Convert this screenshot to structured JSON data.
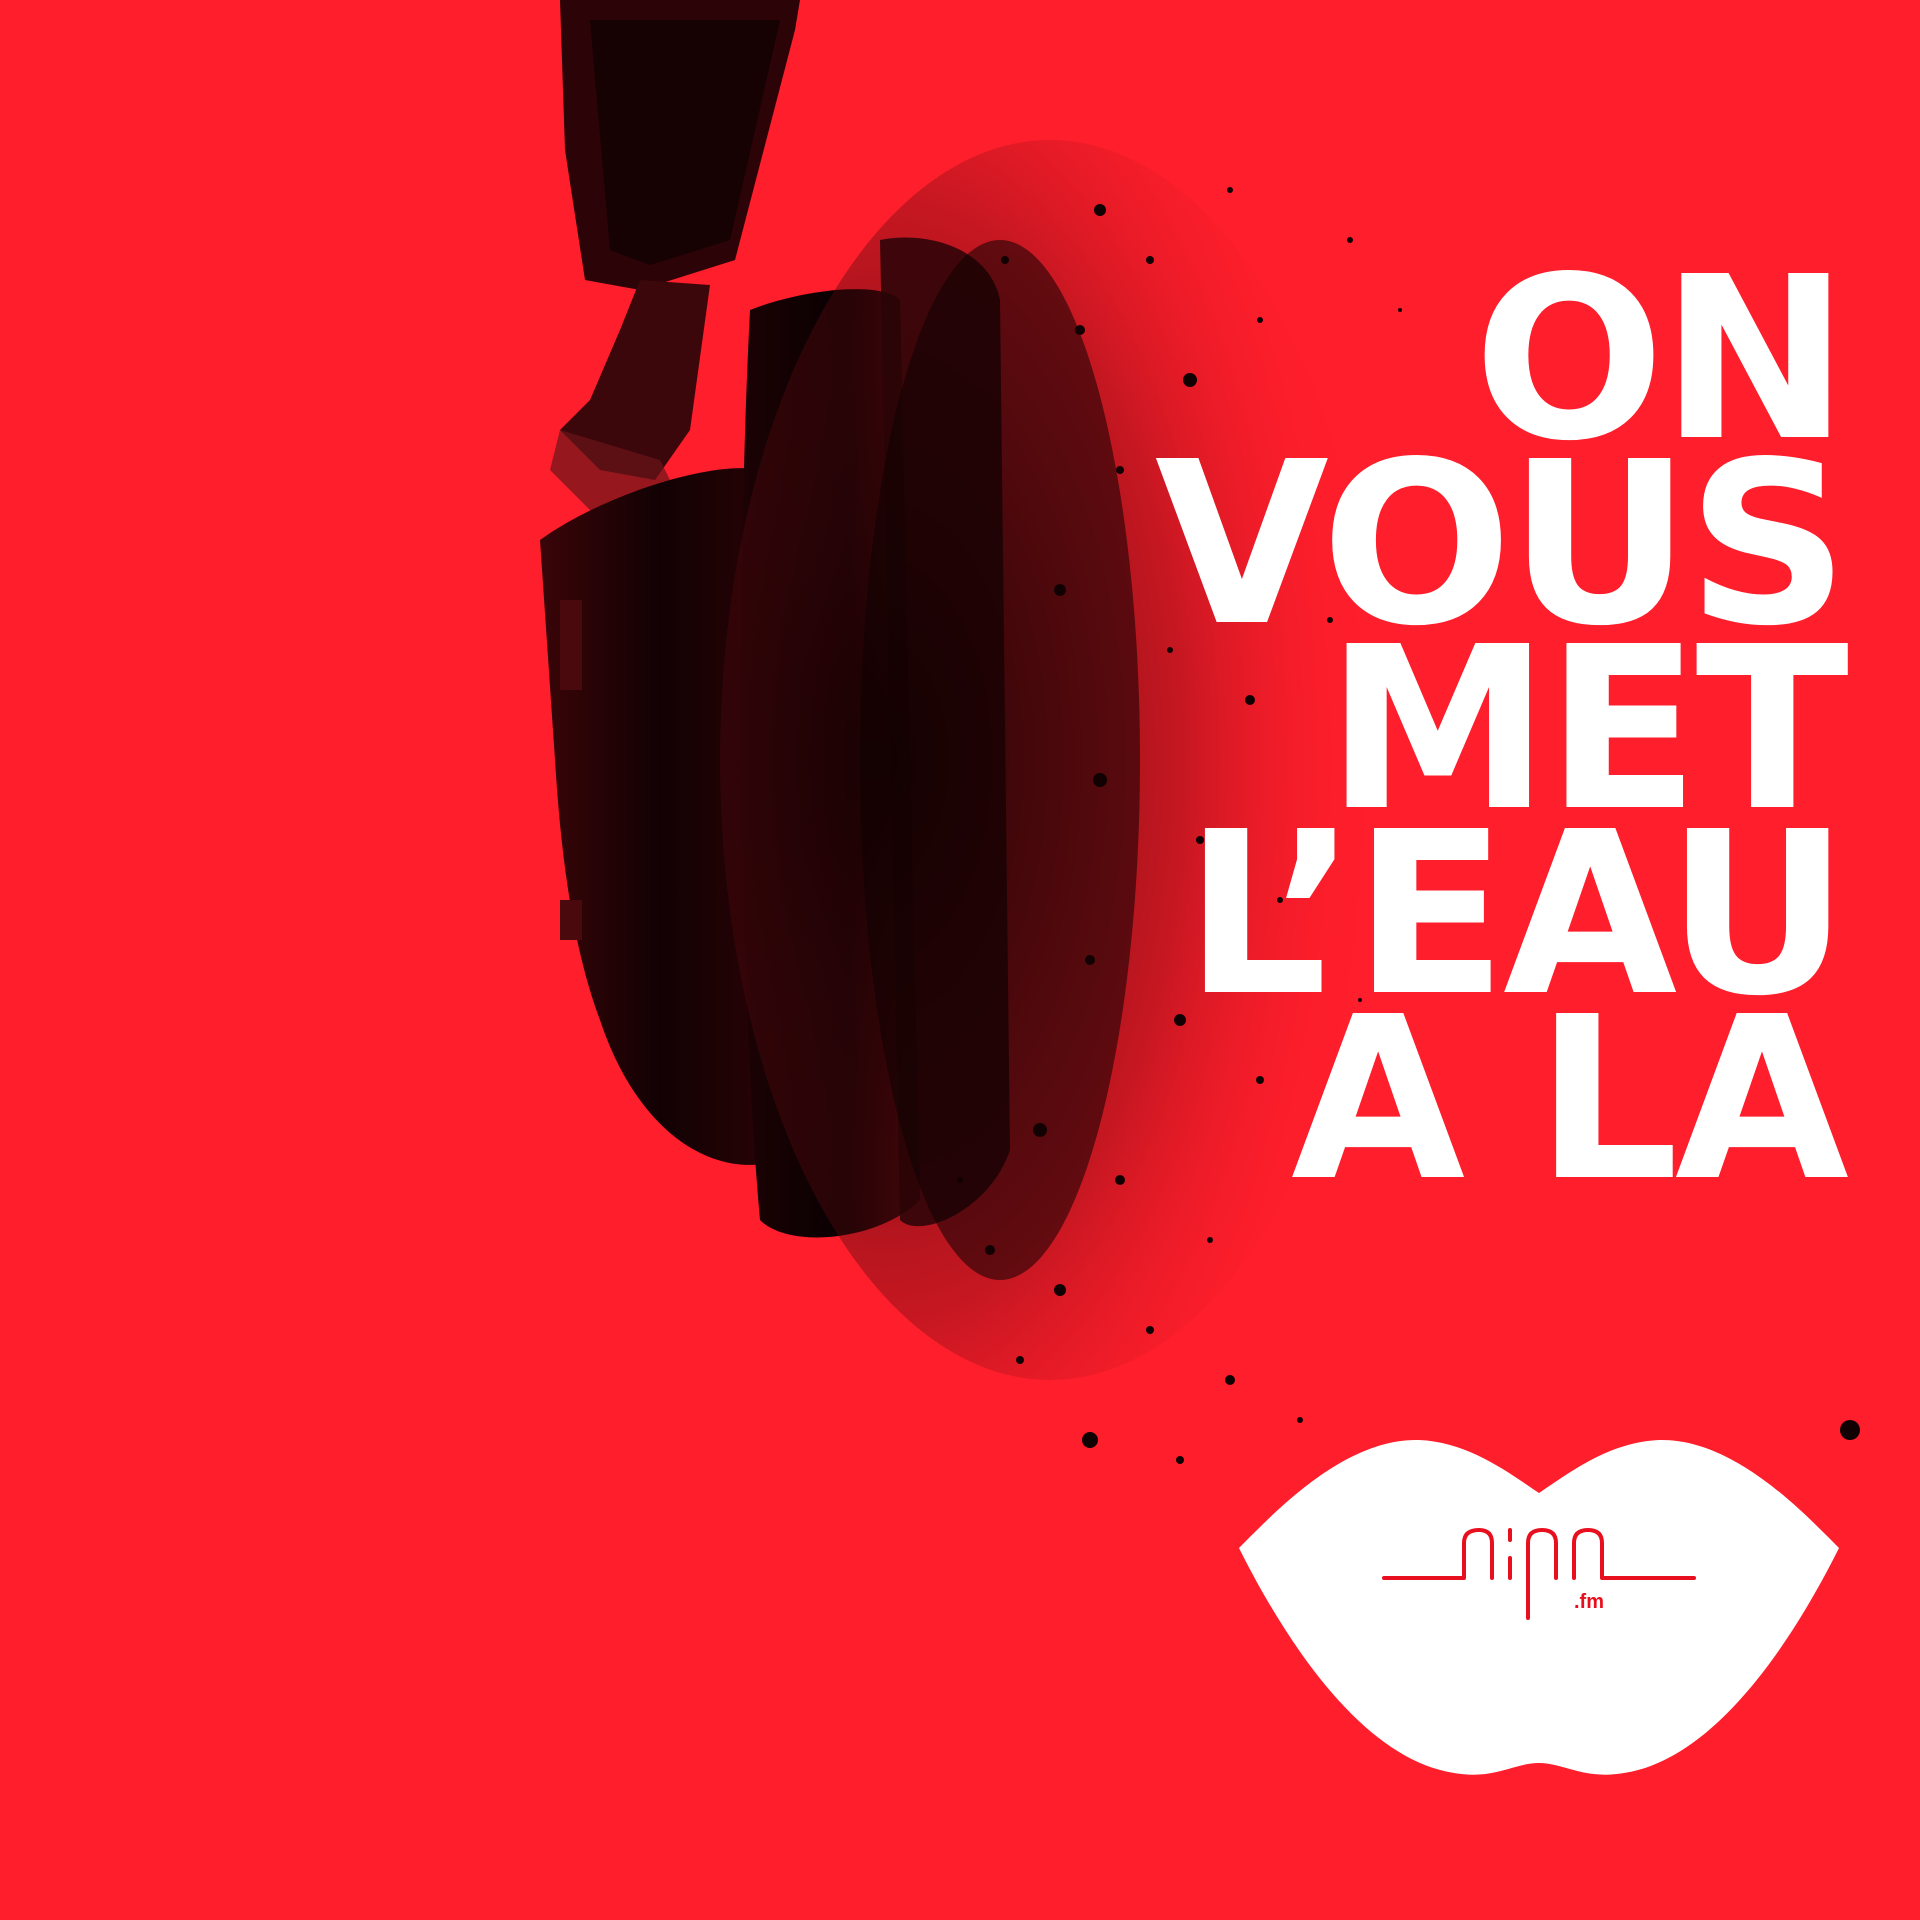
{
  "headline": {
    "lines": [
      "ON",
      "VOUS",
      "MET",
      "L’EAU",
      "A LA"
    ]
  },
  "logo": {
    "name": "nina",
    "suffix": ".fm"
  },
  "colors": {
    "background": "#ff1e2b",
    "text": "#ffffff",
    "headphones": "#1a0204"
  },
  "illustration": {
    "subject": "headphones-disintegrating-into-particles"
  }
}
